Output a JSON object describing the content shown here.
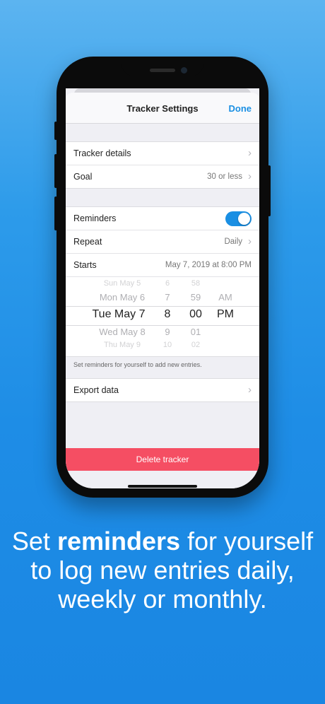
{
  "nav": {
    "title": "Tracker Settings",
    "done": "Done"
  },
  "group1": [
    {
      "label": "Tracker details",
      "value": ""
    },
    {
      "label": "Goal",
      "value": "30 or less"
    }
  ],
  "reminders": {
    "label": "Reminders",
    "enabled": true
  },
  "repeat": {
    "label": "Repeat",
    "value": "Daily"
  },
  "starts": {
    "label": "Starts",
    "value": "May 7, 2019 at 8:00 PM"
  },
  "picker": {
    "dates": [
      "Sun May 5",
      "Mon May 6",
      "Tue May 7",
      "Wed May 8",
      "Thu May 9"
    ],
    "hours": [
      "6",
      "7",
      "8",
      "9",
      "10"
    ],
    "minutes": [
      "58",
      "59",
      "00",
      "01",
      "02"
    ],
    "ampm": [
      "AM",
      "PM"
    ],
    "selected": {
      "date": "Tue May 7",
      "hour": "8",
      "minute": "00",
      "ampm": "PM"
    }
  },
  "reminder_note": "Set reminders for yourself to add new entries.",
  "export": {
    "label": "Export data"
  },
  "delete": {
    "label": "Delete tracker"
  },
  "caption": {
    "prefix": "Set ",
    "bold": "reminders",
    "suffix": " for yourself to log new entries daily, weekly or monthly."
  },
  "colors": {
    "accent": "#1a8fe3",
    "danger": "#f54e63",
    "background": "#1e8de6"
  }
}
